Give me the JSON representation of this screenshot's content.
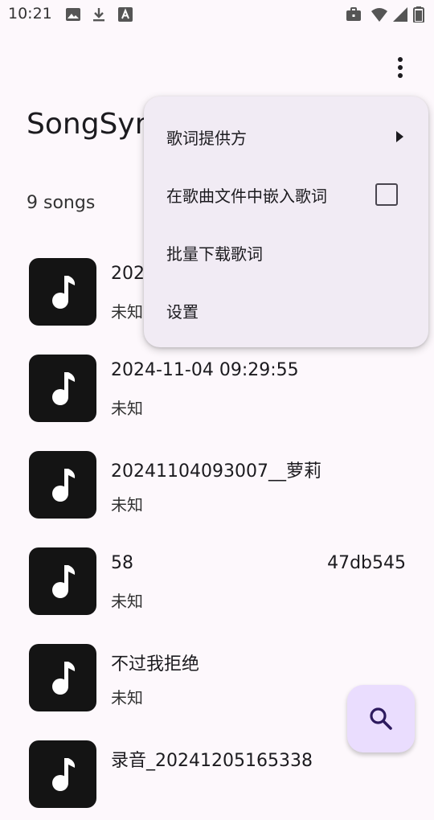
{
  "status_bar": {
    "time": "10:21",
    "left_icons": [
      "image-icon",
      "download-icon",
      "a-box-icon"
    ],
    "right_icons": [
      "briefcase-icon",
      "wifi-icon",
      "signal-icon",
      "battery-icon"
    ]
  },
  "header": {
    "title": "SongSync",
    "overflow_icon": "more-vert-icon"
  },
  "song_count": "9 songs",
  "songs": [
    {
      "title": "202",
      "artist": "未知"
    },
    {
      "title": "2024-11-04 09:29:55",
      "artist": "未知"
    },
    {
      "title": "20241104093007__萝莉",
      "artist": "未知"
    },
    {
      "title": "58",
      "title_right": "47db545",
      "artist": "未知"
    },
    {
      "title": "不过我拒绝",
      "artist": "未知"
    },
    {
      "title": "录音_20241205165338",
      "artist": ""
    }
  ],
  "menu": {
    "items": [
      {
        "label": "歌词提供方",
        "trailing": "submenu-arrow"
      },
      {
        "label": "在歌曲文件中嵌入歌词",
        "trailing": "checkbox",
        "checked": false
      },
      {
        "label": "批量下载歌词"
      },
      {
        "label": "设置"
      }
    ]
  },
  "fab": {
    "icon": "search-icon",
    "color": "#eaddfe",
    "icon_color": "#2d1a5e"
  }
}
